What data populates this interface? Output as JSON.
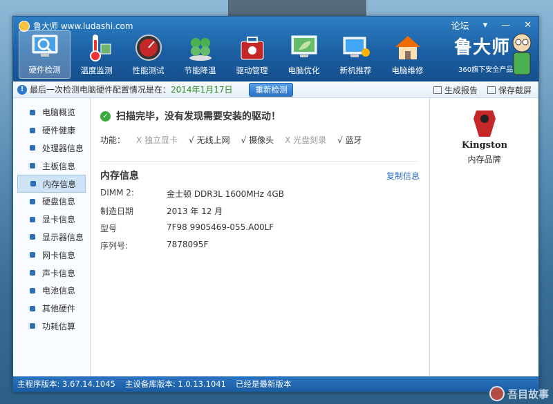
{
  "window": {
    "title": "鲁大师 www.ludashi.com",
    "controls": {
      "forum": "论坛",
      "menu": "▾",
      "minimize": "—",
      "close": "✕"
    }
  },
  "toolbar": {
    "items": [
      {
        "label": "硬件检测",
        "icon": "magnifier-monitor-icon",
        "active": true
      },
      {
        "label": "温度监测",
        "icon": "thermometer-icon",
        "active": false
      },
      {
        "label": "性能测试",
        "icon": "speedometer-icon",
        "active": false
      },
      {
        "label": "节能降温",
        "icon": "clover-icon",
        "active": false
      },
      {
        "label": "驱动管理",
        "icon": "toolbox-icon",
        "active": false
      },
      {
        "label": "电脑优化",
        "icon": "monitor-leaf-icon",
        "active": false
      },
      {
        "label": "新机推荐",
        "icon": "monitor-award-icon",
        "active": false
      },
      {
        "label": "电脑维修",
        "icon": "house-icon",
        "active": false
      }
    ]
  },
  "brand": {
    "name": "鲁大师",
    "subtitle": "360旗下安全产品"
  },
  "infobar": {
    "message": "最后一次检测电脑硬件配置情况是在：",
    "date": "2014年1月17日",
    "rescan_label": "重新检测",
    "report_label": "生成报告",
    "screenshot_label": "保存截屏"
  },
  "sidebar": {
    "items": [
      {
        "label": "电脑概览"
      },
      {
        "label": "硬件健康"
      },
      {
        "label": "处理器信息"
      },
      {
        "label": "主板信息"
      },
      {
        "label": "内存信息"
      },
      {
        "label": "硬盘信息"
      },
      {
        "label": "显卡信息"
      },
      {
        "label": "显示器信息"
      },
      {
        "label": "网卡信息"
      },
      {
        "label": "声卡信息"
      },
      {
        "label": "电池信息"
      },
      {
        "label": "其他硬件"
      },
      {
        "label": "功耗估算"
      }
    ],
    "active_index": 4
  },
  "content": {
    "scan_message": "扫描完毕，没有发现需要安装的驱动！",
    "features_label": "功能：",
    "features": [
      {
        "mark": "X",
        "label": "独立显卡",
        "available": false
      },
      {
        "mark": "√",
        "label": "无线上网",
        "available": true
      },
      {
        "mark": "√",
        "label": "摄像头",
        "available": true
      },
      {
        "mark": "X",
        "label": "光盘刻录",
        "available": false
      },
      {
        "mark": "√",
        "label": "蓝牙",
        "available": true
      }
    ],
    "memory": {
      "title": "内存信息",
      "copy_label": "复制信息",
      "rows": [
        {
          "key": "DIMM 2:",
          "value": "金士顿 DDR3L 1600MHz 4GB"
        },
        {
          "key": "制造日期",
          "value": "2013 年 12 月"
        },
        {
          "key": "型号",
          "value": "7F98 9905469-055.A00LF"
        },
        {
          "key": "序列号:",
          "value": "7878095F"
        }
      ]
    }
  },
  "right_panel": {
    "brand_logo": "Kingston",
    "label": "内存品牌"
  },
  "statusbar": {
    "main_version": "主程序版本: 3.67.14.1045",
    "db_version": "主设备库版本: 1.0.13.1041",
    "update_status": "已经是最新版本"
  },
  "watermark": {
    "text": "吾目故事"
  },
  "colors": {
    "accent": "#1b5fa3",
    "active_tab": "#cfe3f7",
    "date_green": "#2a8a1a",
    "link": "#2a6fc2"
  }
}
